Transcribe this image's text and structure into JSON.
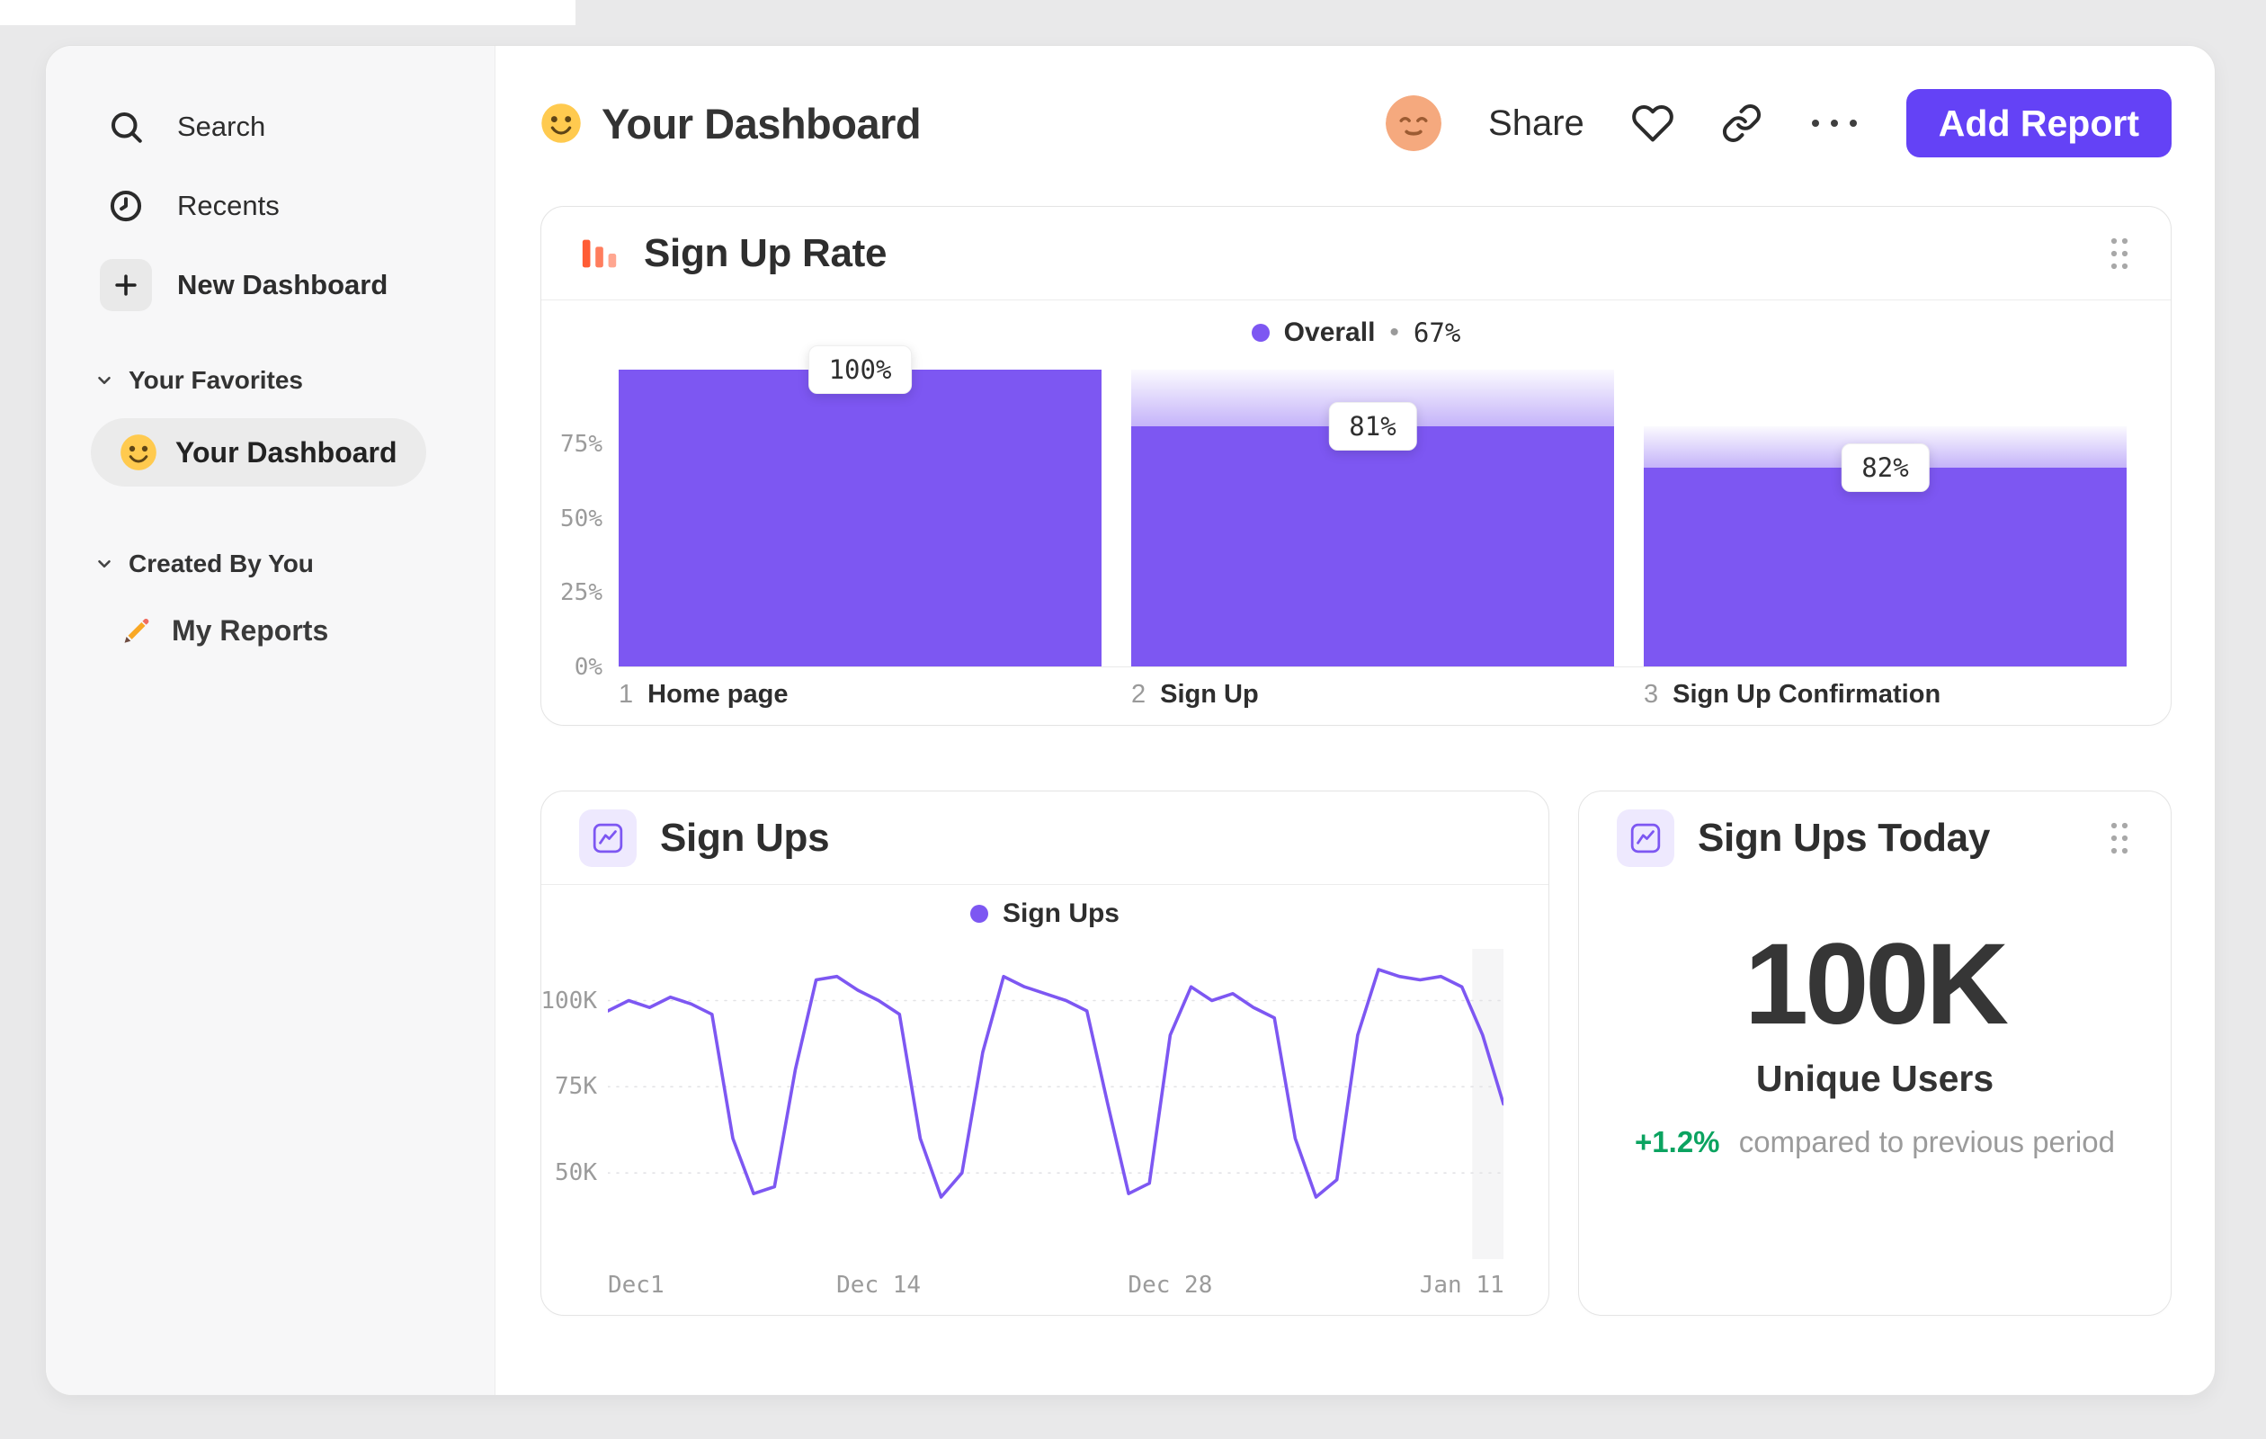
{
  "colors": {
    "accent_purple": "#6442F6",
    "chart_purple": "#7D57F2",
    "orange": "#FF5C35",
    "green": "#0BA360",
    "page_bg": "#E9E9EA",
    "sidebar_bg": "#F7F7F8"
  },
  "sidebar": {
    "nav": [
      {
        "label": "Search",
        "icon": "search-icon"
      },
      {
        "label": "Recents",
        "icon": "clock-icon"
      },
      {
        "label": "New Dashboard",
        "icon": "plus-icon"
      }
    ],
    "sections": [
      {
        "label": "Your Favorites",
        "items": [
          {
            "label": "Your Dashboard",
            "icon": "smiley-emoji",
            "selected": true
          }
        ]
      },
      {
        "label": "Created By You",
        "items": [
          {
            "label": "My Reports",
            "icon": "pencil-emoji"
          }
        ]
      }
    ]
  },
  "header": {
    "title": "Your Dashboard",
    "share_label": "Share",
    "add_report_label": "Add Report"
  },
  "funnel_card": {
    "title": "Sign Up Rate",
    "legend_name": "Overall",
    "legend_sep": "•",
    "legend_value": "67%",
    "ytick_labels": [
      "75%",
      "50%",
      "25%",
      "0%"
    ],
    "columns": [
      {
        "num": "1",
        "label": "Home page",
        "badge": "100%"
      },
      {
        "num": "2",
        "label": "Sign Up",
        "badge": "81%"
      },
      {
        "num": "3",
        "label": "Sign Up Confirmation",
        "badge": "82%"
      }
    ]
  },
  "line_card": {
    "title": "Sign Ups",
    "legend_name": "Sign Ups",
    "ytick_labels": [
      "100K",
      "75K",
      "50K"
    ],
    "xtick_labels": [
      "Dec1",
      "Dec 14",
      "Dec 28",
      "Jan 11"
    ]
  },
  "number_card": {
    "title": "Sign Ups Today",
    "value": "100K",
    "label": "Unique Users",
    "delta": "+1.2%",
    "delta_caption": "compared to previous period"
  },
  "chart_data": [
    {
      "type": "bar",
      "subtype": "funnel",
      "title": "Sign Up Rate",
      "categories": [
        "Home page",
        "Sign Up",
        "Sign Up Confirmation"
      ],
      "step_numbers": [
        1,
        2,
        3
      ],
      "overall_height_pct": [
        100,
        81,
        67
      ],
      "step_conversion_labels": [
        "100%",
        "81%",
        "82%"
      ],
      "overall_conversion_pct": 67,
      "legend": "Overall • 67%",
      "yticks_pct": [
        75,
        50,
        25,
        0
      ],
      "ylim_pct": [
        0,
        100
      ],
      "bar_color": "#7D57F2"
    },
    {
      "type": "line",
      "title": "Sign Ups",
      "series": [
        {
          "name": "Sign Ups",
          "x_days": [
            0,
            1,
            2,
            3,
            4,
            5,
            6,
            7,
            8,
            9,
            10,
            11,
            12,
            13,
            14,
            15,
            16,
            17,
            18,
            19,
            20,
            21,
            22,
            23,
            24,
            25,
            26,
            27,
            28,
            29,
            30,
            31,
            32,
            33,
            34,
            35,
            36,
            37,
            38,
            39,
            40,
            41,
            42,
            43
          ],
          "values_thousands": [
            97,
            100,
            98,
            101,
            99,
            96,
            60,
            44,
            46,
            80,
            106,
            107,
            103,
            100,
            96,
            60,
            43,
            50,
            85,
            107,
            104,
            102,
            100,
            97,
            70,
            44,
            47,
            90,
            104,
            100,
            102,
            98,
            95,
            60,
            43,
            48,
            90,
            109,
            107,
            106,
            107,
            104,
            90,
            70
          ]
        }
      ],
      "xticks": [
        {
          "day": 0,
          "label": "Dec1"
        },
        {
          "day": 13,
          "label": "Dec 14"
        },
        {
          "day": 27,
          "label": "Dec 28"
        },
        {
          "day": 41,
          "label": "Jan 11"
        }
      ],
      "x_max_day": 43,
      "yticks_thousands": [
        100,
        75,
        50
      ],
      "ylim_thousands": [
        25,
        115
      ],
      "incomplete_band_from_day": 41.5,
      "line_color": "#7D57F2",
      "grid": "dotted-horizontal",
      "legend_position": "top-center"
    },
    {
      "type": "number",
      "title": "Sign Ups Today",
      "value": "100K",
      "unit_label": "Unique Users",
      "change_label": "+1.2%",
      "comparison": "compared to previous period"
    }
  ]
}
